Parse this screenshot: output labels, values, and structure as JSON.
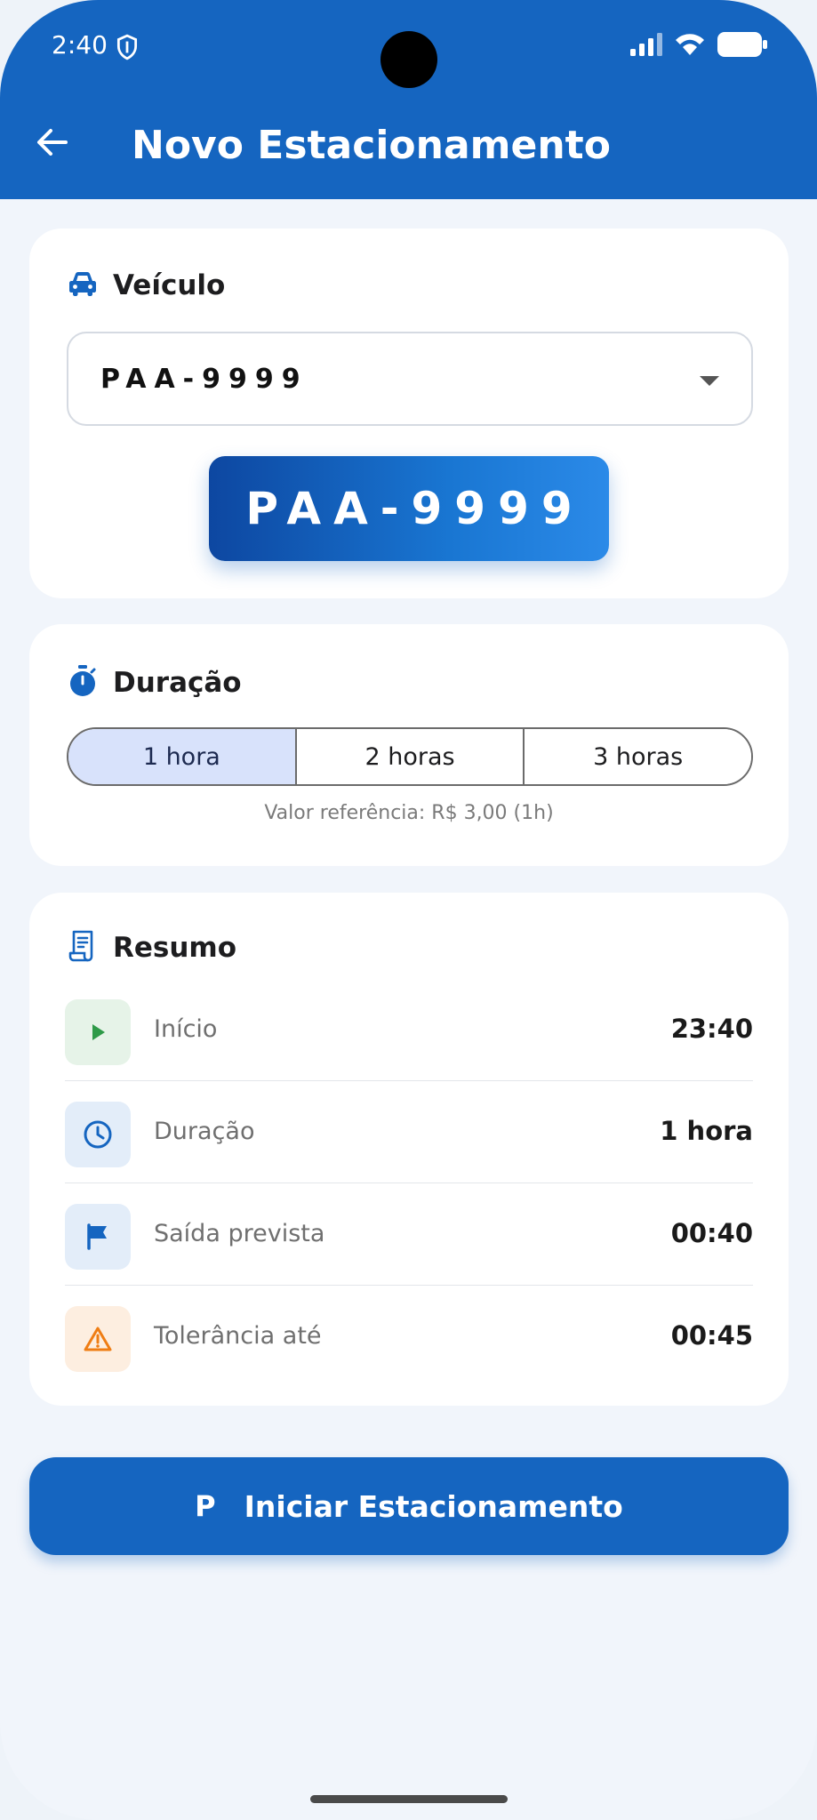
{
  "status_bar": {
    "time": "2:40"
  },
  "header": {
    "title": "Novo Estacionamento"
  },
  "vehicle": {
    "section_title": "Veículo",
    "selected_plate": "PAA-9999",
    "plate_display": "PAA-9999"
  },
  "duration": {
    "section_title": "Duração",
    "options": [
      "1 hora",
      "2 horas",
      "3 horas"
    ],
    "selected_index": 0,
    "reference_text": "Valor referência: R$ 3,00 (1h)"
  },
  "summary": {
    "section_title": "Resumo",
    "rows": [
      {
        "label": "Início",
        "value": "23:40",
        "icon": "play-icon",
        "icon_bg": "#e6f3e8",
        "icon_color": "#2e9a48"
      },
      {
        "label": "Duração",
        "value": "1 hora",
        "icon": "clock-icon",
        "icon_bg": "#e3edf9",
        "icon_color": "#1565c0"
      },
      {
        "label": "Saída prevista",
        "value": "00:40",
        "icon": "flag-icon",
        "icon_bg": "#e3edf9",
        "icon_color": "#1565c0"
      },
      {
        "label": "Tolerância até",
        "value": "00:45",
        "icon": "warning-icon",
        "icon_bg": "#fdeee0",
        "icon_color": "#ef7d14"
      }
    ]
  },
  "action": {
    "icon_letter": "P",
    "label": "Iniciar Estacionamento"
  },
  "colors": {
    "primary": "#1565c0",
    "background": "#f1f5fb",
    "segment_active": "#d8e2fb"
  }
}
